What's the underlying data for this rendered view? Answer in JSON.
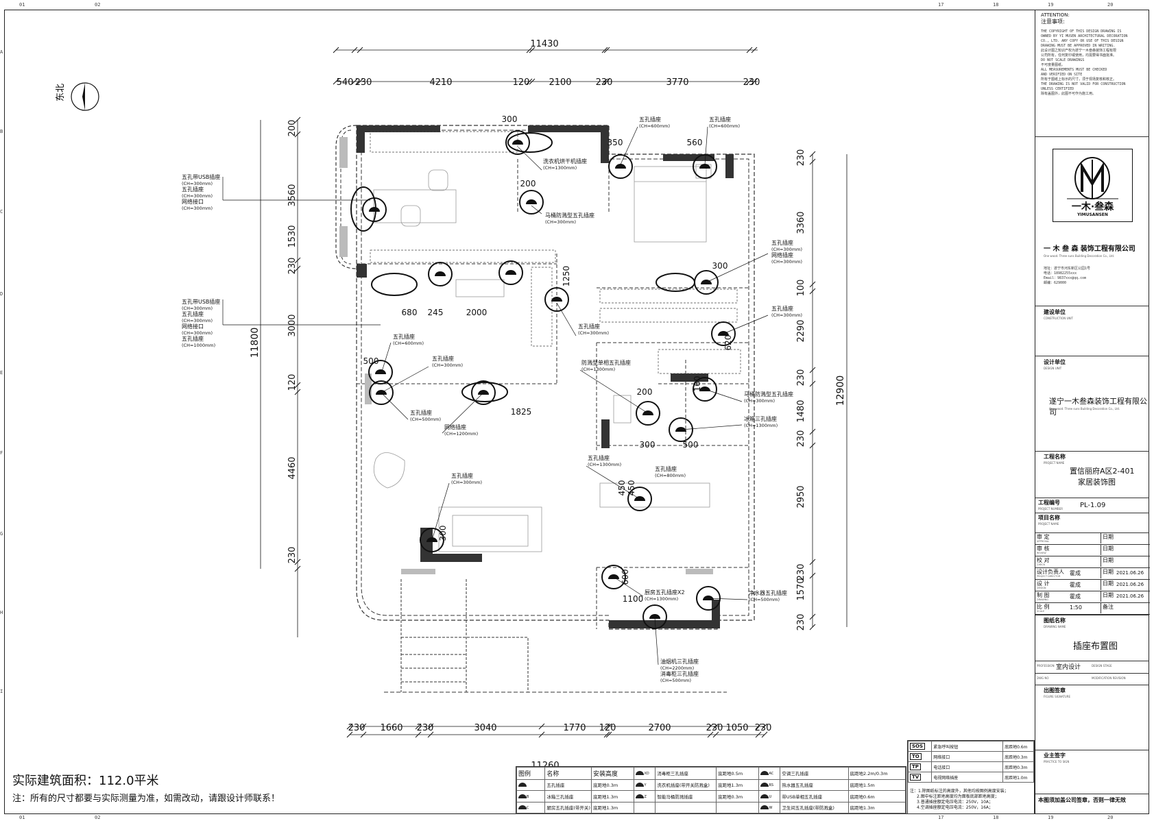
{
  "ruler": {
    "top": [
      "01",
      "02",
      "17",
      "18",
      "19",
      "20"
    ],
    "side": [
      "A",
      "B",
      "C",
      "D",
      "E",
      "F",
      "G",
      "H",
      "I"
    ]
  },
  "north": {
    "label": "东北"
  },
  "dims": {
    "overall_top": "11430",
    "top": [
      "540",
      "230",
      "4210",
      "120",
      "2100",
      "230",
      "3770",
      "230"
    ],
    "overall_bottom": "11260",
    "bottom": [
      "230",
      "1660",
      "230",
      "3040",
      "1770",
      "120",
      "2700",
      "230",
      "1050",
      "230"
    ],
    "left_overall": "11800",
    "left": [
      "200",
      "3560",
      "1530",
      "230",
      "3000",
      "120",
      "4460",
      "230"
    ],
    "right_overall": "12900",
    "right": [
      "230",
      "3360",
      "100",
      "2290",
      "230",
      "1480",
      "230",
      "2950",
      "230",
      "1570",
      "230"
    ],
    "inner": [
      "300",
      "350",
      "560",
      "200",
      "300",
      "680",
      "245",
      "2000",
      "1250",
      "620",
      "500",
      "160",
      "200",
      "1825",
      "300",
      "500",
      "450",
      "450",
      "300",
      "600",
      "1100"
    ]
  },
  "callouts": [
    {
      "name": "wash-dryer",
      "lines": [
        "洗衣机烘干机插座",
        "(CH=1300mm)"
      ]
    },
    {
      "name": "toilet-1",
      "lines": [
        "马桶防溅型五孔插座",
        "(CH=300mm)"
      ]
    },
    {
      "name": "bed-left",
      "lines": [
        "五孔插座",
        "(CH=600mm)"
      ]
    },
    {
      "name": "bed-right",
      "lines": [
        "五孔插座",
        "(CH=600mm)"
      ]
    },
    {
      "name": "living-usb",
      "lines": [
        "五孔带USB插座",
        "(CH=300mm)",
        "五孔插座",
        "(CH=300mm)",
        "网络接口",
        "(CH=300mm)"
      ]
    },
    {
      "name": "bedroom2-usb",
      "lines": [
        "五孔带USB插座",
        "(CH=300mm)",
        "五孔插座",
        "(CH=300mm)",
        "网络接口",
        "(CH=300mm)",
        "五孔插座",
        "(CH=1000mm)"
      ]
    },
    {
      "name": "bed-wall-right",
      "lines": [
        "五孔插座",
        "(CH=300mm)",
        "网络插座",
        "(CH=300mm)"
      ]
    },
    {
      "name": "study-right",
      "lines": [
        "五孔插座",
        "(CH=300mm)"
      ]
    },
    {
      "name": "corridor",
      "lines": [
        "五孔插座",
        "(CH=300mm)"
      ]
    },
    {
      "name": "study-desk",
      "lines": [
        "五孔插座",
        "(CH=600mm)"
      ]
    },
    {
      "name": "study-low",
      "lines": [
        "五孔插座",
        "(CH=300mm)"
      ]
    },
    {
      "name": "bath2-socket",
      "lines": [
        "防溅型单相五孔插座",
        "(CH=1300mm)"
      ]
    },
    {
      "name": "toilet-2",
      "lines": [
        "马桶防溅型五孔插座",
        "(CH=300mm)"
      ]
    },
    {
      "name": "fridge",
      "lines": [
        "冰箱三孔插座",
        "(CH=1300mm)"
      ]
    },
    {
      "name": "living-500",
      "lines": [
        "五孔插座",
        "(CH=500mm)"
      ]
    },
    {
      "name": "network",
      "lines": [
        "网络插座",
        "(CH=1200mm)"
      ]
    },
    {
      "name": "kitchen-wall",
      "lines": [
        "五孔插座",
        "(CH=1300mm)"
      ]
    },
    {
      "name": "dining",
      "lines": [
        "五孔插座",
        "(CH=800mm)"
      ]
    },
    {
      "name": "sofa",
      "lines": [
        "五孔插座",
        "(CH=300mm)"
      ]
    },
    {
      "name": "kitchen-x2",
      "lines": [
        "厨房五孔插座X2",
        "(CH=1300mm)"
      ]
    },
    {
      "name": "water-purifier",
      "lines": [
        "净水器五孔插座",
        "(CH=500mm)"
      ]
    },
    {
      "name": "hood",
      "lines": [
        "油烟机三孔插座",
        "(CH=2200mm)",
        "消毒柜三孔插座",
        "(CH=500mm)"
      ]
    }
  ],
  "bottom_text": {
    "area": "实际建筑面积：112.0平米",
    "note": "注：所有的尺寸都要与实际测量为准，如需改动，请跟设计师联系！"
  },
  "legend": {
    "headers": [
      "图例",
      "名称",
      "安装高度"
    ],
    "rows": [
      [
        [
          "",
          "五孔插座",
          "底距地0.3m"
        ],
        [
          "XD",
          "消毒柜三孔插座",
          "底距地0.5m"
        ],
        [
          "AC",
          "空调三孔插座",
          "底距地2.2m/0.3m"
        ]
      ],
      [
        [
          "B",
          "冰箱三孔插座",
          "底距地1.3m"
        ],
        [
          "Y",
          "洗衣机插座(带开关防溅盒)",
          "底距地1.3m"
        ],
        [
          "RS",
          "热水器五孔插座",
          "底距地1.5m"
        ]
      ],
      [
        [
          "C",
          "厨房五孔插座(带开关)",
          "底距地1.3m"
        ],
        [
          "Z",
          "智能马桶防溅插座",
          "底距地0.3m"
        ],
        [
          "U",
          "带USB单相五孔插座",
          "底距地0.6m"
        ]
      ]
    ],
    "extra_row": [
      [
        "W",
        "卫生间五孔插座(带防溅盒)",
        "底距地1.3m"
      ]
    ]
  },
  "legend2": {
    "rows": [
      [
        "SOS",
        "紧急呼叫按钮",
        "底距地0.6m"
      ],
      [
        "TO",
        "网络接口",
        "底距地0.3m"
      ],
      [
        "TP",
        "电话接口",
        "底距地0.3m"
      ],
      [
        "TV",
        "电视网络插座",
        "底距地1.0m"
      ]
    ],
    "notes": [
      "注：1.除图纸标注的高度外，其他均按图例高度安装；",
      "2.图中标注距地高度均为面板底部距地高度；",
      "3.普通插座额定电压电流：250V，10A；",
      "4.空调插座额定电压电流：250V，16A；"
    ]
  },
  "titleblock": {
    "attention_title": "ATTENTION:",
    "attention_cn": "注意事项:",
    "attention_body": [
      "THE COPYRIGHT OF THIS DESIGN DRAWING IS",
      "OWNED BY YI MUSEN ARCHITECTURAL DECORATION",
      "CO., LTD. ANY COPY OR USE OF THIS DESIGN",
      "DRAWING MUST BE APPROVED IN WRITING.",
      "此设计图之知识产权为遂宁一木叁森装饰工程有限",
      "公司所有，任何复印或使用，均需要得书面批准。",
      "DO NOT SCALE DRAWINGS",
      "不可度量图纸。",
      "ALL MEASUREMENTS MUST BE CHECKED",
      "AND VERIFIED ON SITE",
      "所有于图纸上标示的尺寸，须于现场复核和核正。",
      "THE DRAWING IS NOT VALID FOR CONSTRUCTION",
      "UNLESS CERTIFIED",
      "除有盖图外，此图不可作为施工用。"
    ],
    "logo_text": "一木·叁森",
    "logo_en": "YIMUSANSEN",
    "company": "一 木 叁 森  装饰工程有限公司",
    "company_en": "One wood. Three suns Building Decoration Co., Ltd.",
    "contact": [
      "地址：遂宁市河东新区公园1号",
      "电话：18982255xxx",
      "Email：9837xxx@qq.com",
      "邮编：629000"
    ],
    "construction_unit": "建设单位",
    "construction_unit_en": "CONSTRUCTION UNIT",
    "design_unit": "设计单位",
    "design_unit_en": "DESIGN UNIT",
    "design_unit_name": "遂宁一木叁森装饰工程有限公司",
    "design_unit_en_name": "One wood. Three suns Building Decoration Co., Ltd.",
    "project_label": "工程名称",
    "project_label_en": "PROJECT NAME",
    "project_name_1": "置信丽府A区2-401",
    "project_name_2": "家居装饰图",
    "proj_no_label": "工程编号",
    "proj_no_en": "PROJECT NUMBER",
    "proj_no": "PL-1.09",
    "item_label": "项目名称",
    "item_en": "PROJECT NAME",
    "signoffs": [
      {
        "label": "审  定",
        "en": "APPROVAL",
        "name": "",
        "date_label": "日期",
        "date": ""
      },
      {
        "label": "审  核",
        "en": "REVIEW",
        "name": "",
        "date_label": "日期",
        "date": ""
      },
      {
        "label": "校  对",
        "en": "CHECK",
        "name": "",
        "date_label": "日期",
        "date": ""
      },
      {
        "label": "设计负责人",
        "en": "PROJECT DIRECTOR",
        "name": "霍成",
        "date_label": "日期",
        "date": "2021.06.26"
      },
      {
        "label": "设  计",
        "en": "DESIGN",
        "name": "霍成",
        "date_label": "日期",
        "date": "2021.06.26"
      },
      {
        "label": "制  图",
        "en": "DRAWING",
        "name": "霍成",
        "date_label": "日期",
        "date": "2021.06.26"
      },
      {
        "label": "比  例",
        "en": "SCALE",
        "name": "1:50",
        "date_label": "备注",
        "date": ""
      }
    ],
    "drawing_name_label": "图纸名称",
    "drawing_name_en": "DRAWING NAME",
    "drawing_name": "插座布置图",
    "profession_en": "PROFESSION",
    "profession": "室内设计",
    "stage_en": "DESIGN STAGE",
    "dwg_no_en": "DWG NO",
    "modification_en": "MODIFICATION REVISION",
    "seal_label": "出图签章",
    "seal_en": "FIGURE SIGNATURE",
    "owner_label": "业主签字",
    "owner_en": "PRACTICE TO SIGN",
    "footer": "本图须加盖公司签章，否则一律无效"
  },
  "colors": {
    "line": "#111111",
    "wall": "#333333",
    "dash": "#333333",
    "furniture": "#999999"
  }
}
